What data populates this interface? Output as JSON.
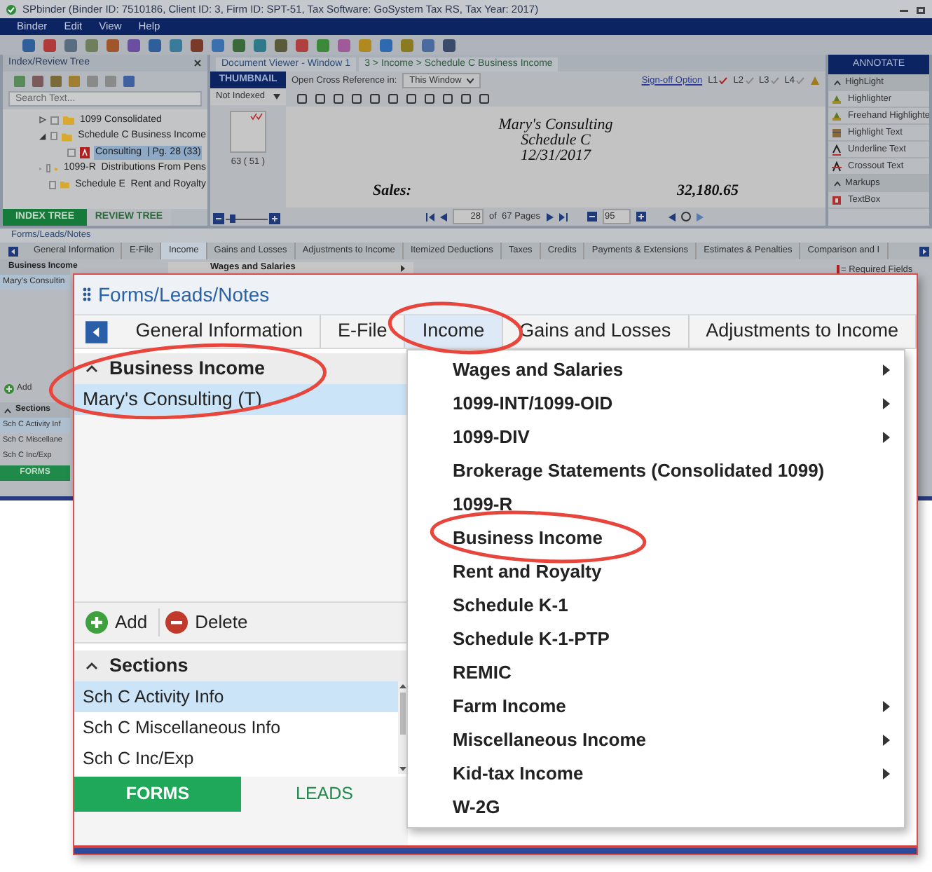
{
  "app": {
    "title": "SPbinder (Binder ID: 7510186, Client ID: 3, Firm ID: SPT-51, Tax Software: GoSystem Tax RS, Tax Year: 2017)",
    "menu": [
      "Binder",
      "Edit",
      "View",
      "Help"
    ]
  },
  "index_tree": {
    "title": "Index/Review Tree",
    "search_placeholder": "Search Text...",
    "items": [
      {
        "kind": "folder",
        "label": "1099 Consolidated",
        "expanded": false,
        "checked": false,
        "selected": false
      },
      {
        "kind": "folder",
        "label": "Schedule C Business Income",
        "expanded": true,
        "checked": false,
        "selected": false,
        "children": [
          {
            "kind": "pdf",
            "label": "Consulting  | Pg. 28 (33)",
            "checked": false,
            "selected": true
          }
        ]
      },
      {
        "kind": "folder",
        "label": "1099-R  Distributions From Pens",
        "expanded": false,
        "checked": false,
        "selected": false
      },
      {
        "kind": "folder",
        "label": "Schedule E  Rent and Royalty",
        "checked": false,
        "selected": false
      }
    ],
    "tabs": [
      {
        "label": "INDEX TREE",
        "selected": true
      },
      {
        "label": "REVIEW TREE",
        "selected": false
      }
    ]
  },
  "document_viewer": {
    "tab": "Document Viewer - Window 1",
    "breadcrumb": "3 > Income > Schedule C Business Income",
    "thumbnail_header": "THUMBNAIL",
    "filter": "Not Indexed",
    "thumbnail_caption": "63 ( 51 )",
    "thumbnail_zoom": {
      "level": 0.1
    },
    "cross_reference_label": "Open Cross Reference in:",
    "cross_reference_value": "This Window",
    "signoff": "Sign-off Option",
    "levels": [
      {
        "label": "L1",
        "signed": true
      },
      {
        "label": "L2",
        "signed": false
      },
      {
        "label": "L3",
        "signed": false
      },
      {
        "label": "L4",
        "signed": false
      }
    ],
    "document_lines": [
      "Mary's Consulting",
      "Schedule C",
      "12/31/2017"
    ],
    "sales_label": "Sales:",
    "sales_value": "32,180.65",
    "page": "28",
    "page_count": "of  67 Pages",
    "zoom": "95"
  },
  "annotate": {
    "title": "ANNOTATE",
    "sections": [
      {
        "label": "HighLight",
        "items": [
          {
            "label": "Highlighter",
            "kind": "marker"
          },
          {
            "label": "Freehand Highlighte",
            "kind": "marker"
          },
          {
            "label": "Highlight Text",
            "kind": "bar"
          },
          {
            "label": "Underline Text",
            "kind": "underline"
          },
          {
            "label": "Crossout Text",
            "kind": "strike"
          }
        ]
      },
      {
        "label": "Markups",
        "items": [
          {
            "label": "TextBox",
            "kind": "textbox"
          }
        ]
      }
    ]
  },
  "forms_panel": {
    "title": "Forms/Leads/Notes",
    "tabs": [
      {
        "label": "General Information",
        "selected": false
      },
      {
        "label": "E-File",
        "selected": false
      },
      {
        "label": "Income",
        "selected": true
      },
      {
        "label": "Gains and Losses",
        "selected": false
      },
      {
        "label": "Adjustments to Income",
        "selected": false
      },
      {
        "label": "Itemized Deductions",
        "selected": false
      },
      {
        "label": "Taxes",
        "selected": false
      },
      {
        "label": "Credits",
        "selected": false
      },
      {
        "label": "Payments & Extensions",
        "selected": false
      },
      {
        "label": "Estimates & Penalties",
        "selected": false
      },
      {
        "label": "Comparison and I",
        "selected": false
      }
    ],
    "group": "Business Income",
    "entry": "Mary's Consultin",
    "menu_first": "Wages and Salaries",
    "required_note": "= Required Fields",
    "add": "Add",
    "sections_title": "Sections",
    "sections": [
      "Sch C Activity Inf",
      "Sch C Miscellane",
      "Sch C Inc/Exp"
    ],
    "bottom_tab": "FORMS"
  },
  "zoomed_panel": {
    "title": "Forms/Leads/Notes",
    "tabs": [
      {
        "label": "General Information",
        "selected": false
      },
      {
        "label": "E-File",
        "selected": false
      },
      {
        "label": "Income",
        "selected": true
      },
      {
        "label": "Gains and Losses",
        "selected": false
      },
      {
        "label": "Adjustments to Income",
        "selected": false
      }
    ],
    "group": "Business Income",
    "entries": [
      {
        "label": "Mary's Consulting (T)",
        "selected": true
      }
    ],
    "add": "Add",
    "delete": "Delete",
    "sections_title": "Sections",
    "sections": [
      {
        "label": "Sch C Activity Info",
        "selected": true
      },
      {
        "label": "Sch C Miscellaneous Info",
        "selected": false
      },
      {
        "label": "Sch C Inc/Exp",
        "selected": false
      }
    ],
    "bottom_tabs": [
      {
        "label": "FORMS",
        "selected": true
      },
      {
        "label": "LEADS",
        "selected": false
      }
    ],
    "menu": [
      {
        "label": "Wages and Salaries",
        "submenu": true
      },
      {
        "label": "1099-INT/1099-OID",
        "submenu": true
      },
      {
        "label": "1099-DIV",
        "submenu": true
      },
      {
        "label": "Brokerage Statements (Consolidated 1099)",
        "submenu": false
      },
      {
        "label": "1099-R",
        "submenu": false
      },
      {
        "label": "Business Income",
        "submenu": false
      },
      {
        "label": "Rent and Royalty",
        "submenu": false
      },
      {
        "label": "Schedule K-1",
        "submenu": false
      },
      {
        "label": "Schedule K-1-PTP",
        "submenu": false
      },
      {
        "label": "REMIC",
        "submenu": false
      },
      {
        "label": "Farm Income",
        "submenu": true
      },
      {
        "label": "Miscellaneous Income",
        "submenu": true
      },
      {
        "label": "Kid-tax Income",
        "submenu": true
      },
      {
        "label": "W-2G",
        "submenu": false
      }
    ]
  }
}
